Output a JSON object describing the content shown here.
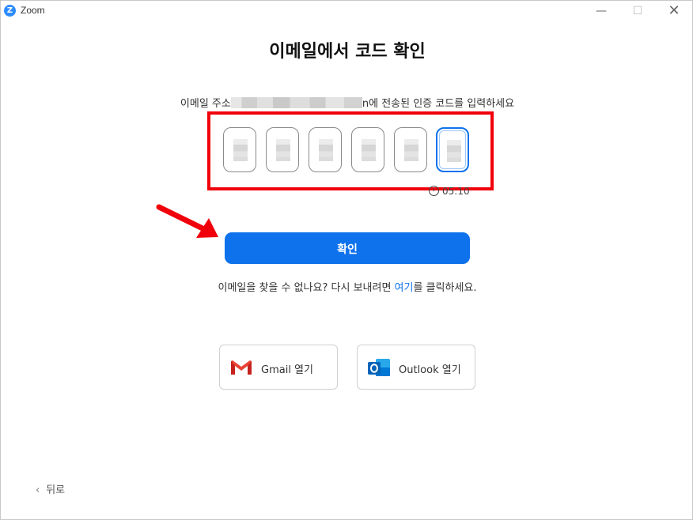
{
  "window": {
    "title": "Zoom",
    "logo_letter": "Z",
    "controls": {
      "minimize": "—",
      "maximize": "☐",
      "close": "✕"
    }
  },
  "heading": "이메일에서 코드 확인",
  "instruction": {
    "prefix": "이메일 주소",
    "suffix": "n에 전송된 인증 코드를 입력하세요"
  },
  "code": {
    "digit_count": 6,
    "active_index": 5
  },
  "timer": "05:10",
  "confirm_label": "확인",
  "resend": {
    "prefix": "이메일을 찾을 수 없나요? 다시 보내려면 ",
    "link": "여기",
    "suffix": "를 클릭하세요."
  },
  "open_buttons": {
    "gmail_label": "Gmail 열기",
    "outlook_label": "Outlook 열기"
  },
  "back_label": "뒤로",
  "colors": {
    "accent": "#0e72ed",
    "highlight": "#f0000a",
    "zoom_brand": "#2d8cff"
  }
}
